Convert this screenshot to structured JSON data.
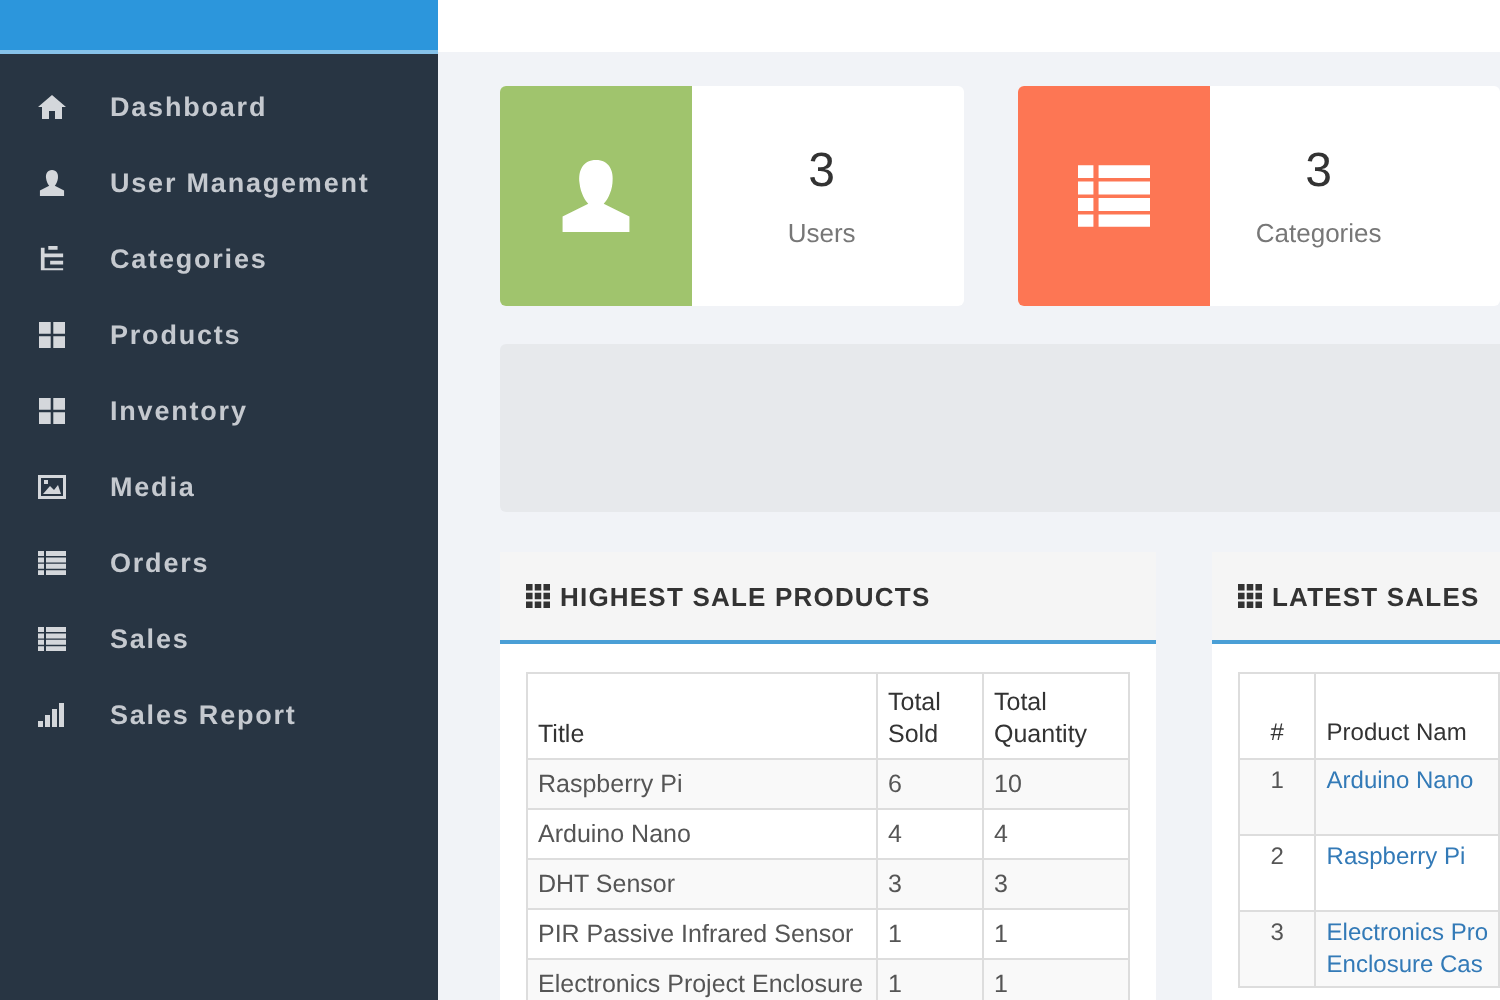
{
  "sidebar": {
    "items": [
      {
        "label": "Dashboard"
      },
      {
        "label": "User Management"
      },
      {
        "label": "Categories"
      },
      {
        "label": "Products"
      },
      {
        "label": "Inventory"
      },
      {
        "label": "Media"
      },
      {
        "label": "Orders"
      },
      {
        "label": "Sales"
      },
      {
        "label": "Sales Report"
      }
    ]
  },
  "stats": [
    {
      "value": "3",
      "label": "Users",
      "color": "#a0c46d"
    },
    {
      "value": "3",
      "label": "Categories",
      "color": "#fd7654"
    }
  ],
  "highest_sale_products": {
    "title": "HIGHEST SALE PRODUCTS",
    "columns": [
      "Title",
      "Total Sold",
      "Total Quantity"
    ],
    "rows": [
      [
        "Raspberry Pi",
        "6",
        "10"
      ],
      [
        "Arduino Nano",
        "4",
        "4"
      ],
      [
        "DHT Sensor",
        "3",
        "3"
      ],
      [
        "PIR Passive Infrared Sensor",
        "1",
        "1"
      ],
      [
        "Electronics Project Enclosure",
        "1",
        "1"
      ]
    ]
  },
  "latest_sales": {
    "title": "LATEST SALES",
    "columns": [
      "#",
      "Product Nam"
    ],
    "rows": [
      [
        "1",
        "Arduino Nano"
      ],
      [
        "2",
        "Raspberry Pi"
      ],
      [
        "3",
        "Electronics Pro\nEnclosure Cas"
      ]
    ]
  }
}
